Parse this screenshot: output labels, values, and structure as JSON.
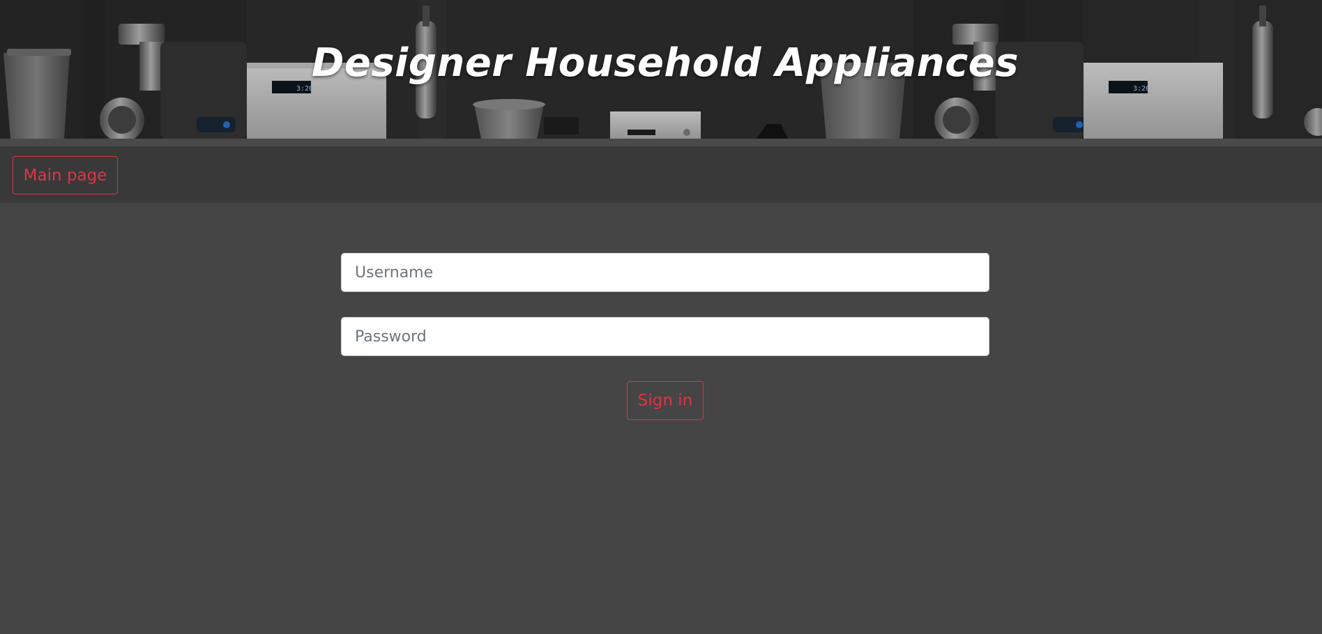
{
  "banner": {
    "title": "Designer Household Appliances"
  },
  "nav": {
    "main_page_label": "Main page"
  },
  "login": {
    "username_placeholder": "Username",
    "password_placeholder": "Password",
    "sign_in_label": "Sign in"
  },
  "colors": {
    "accent": "#dc3545",
    "page_background": "#454545",
    "nav_background": "#393939"
  }
}
